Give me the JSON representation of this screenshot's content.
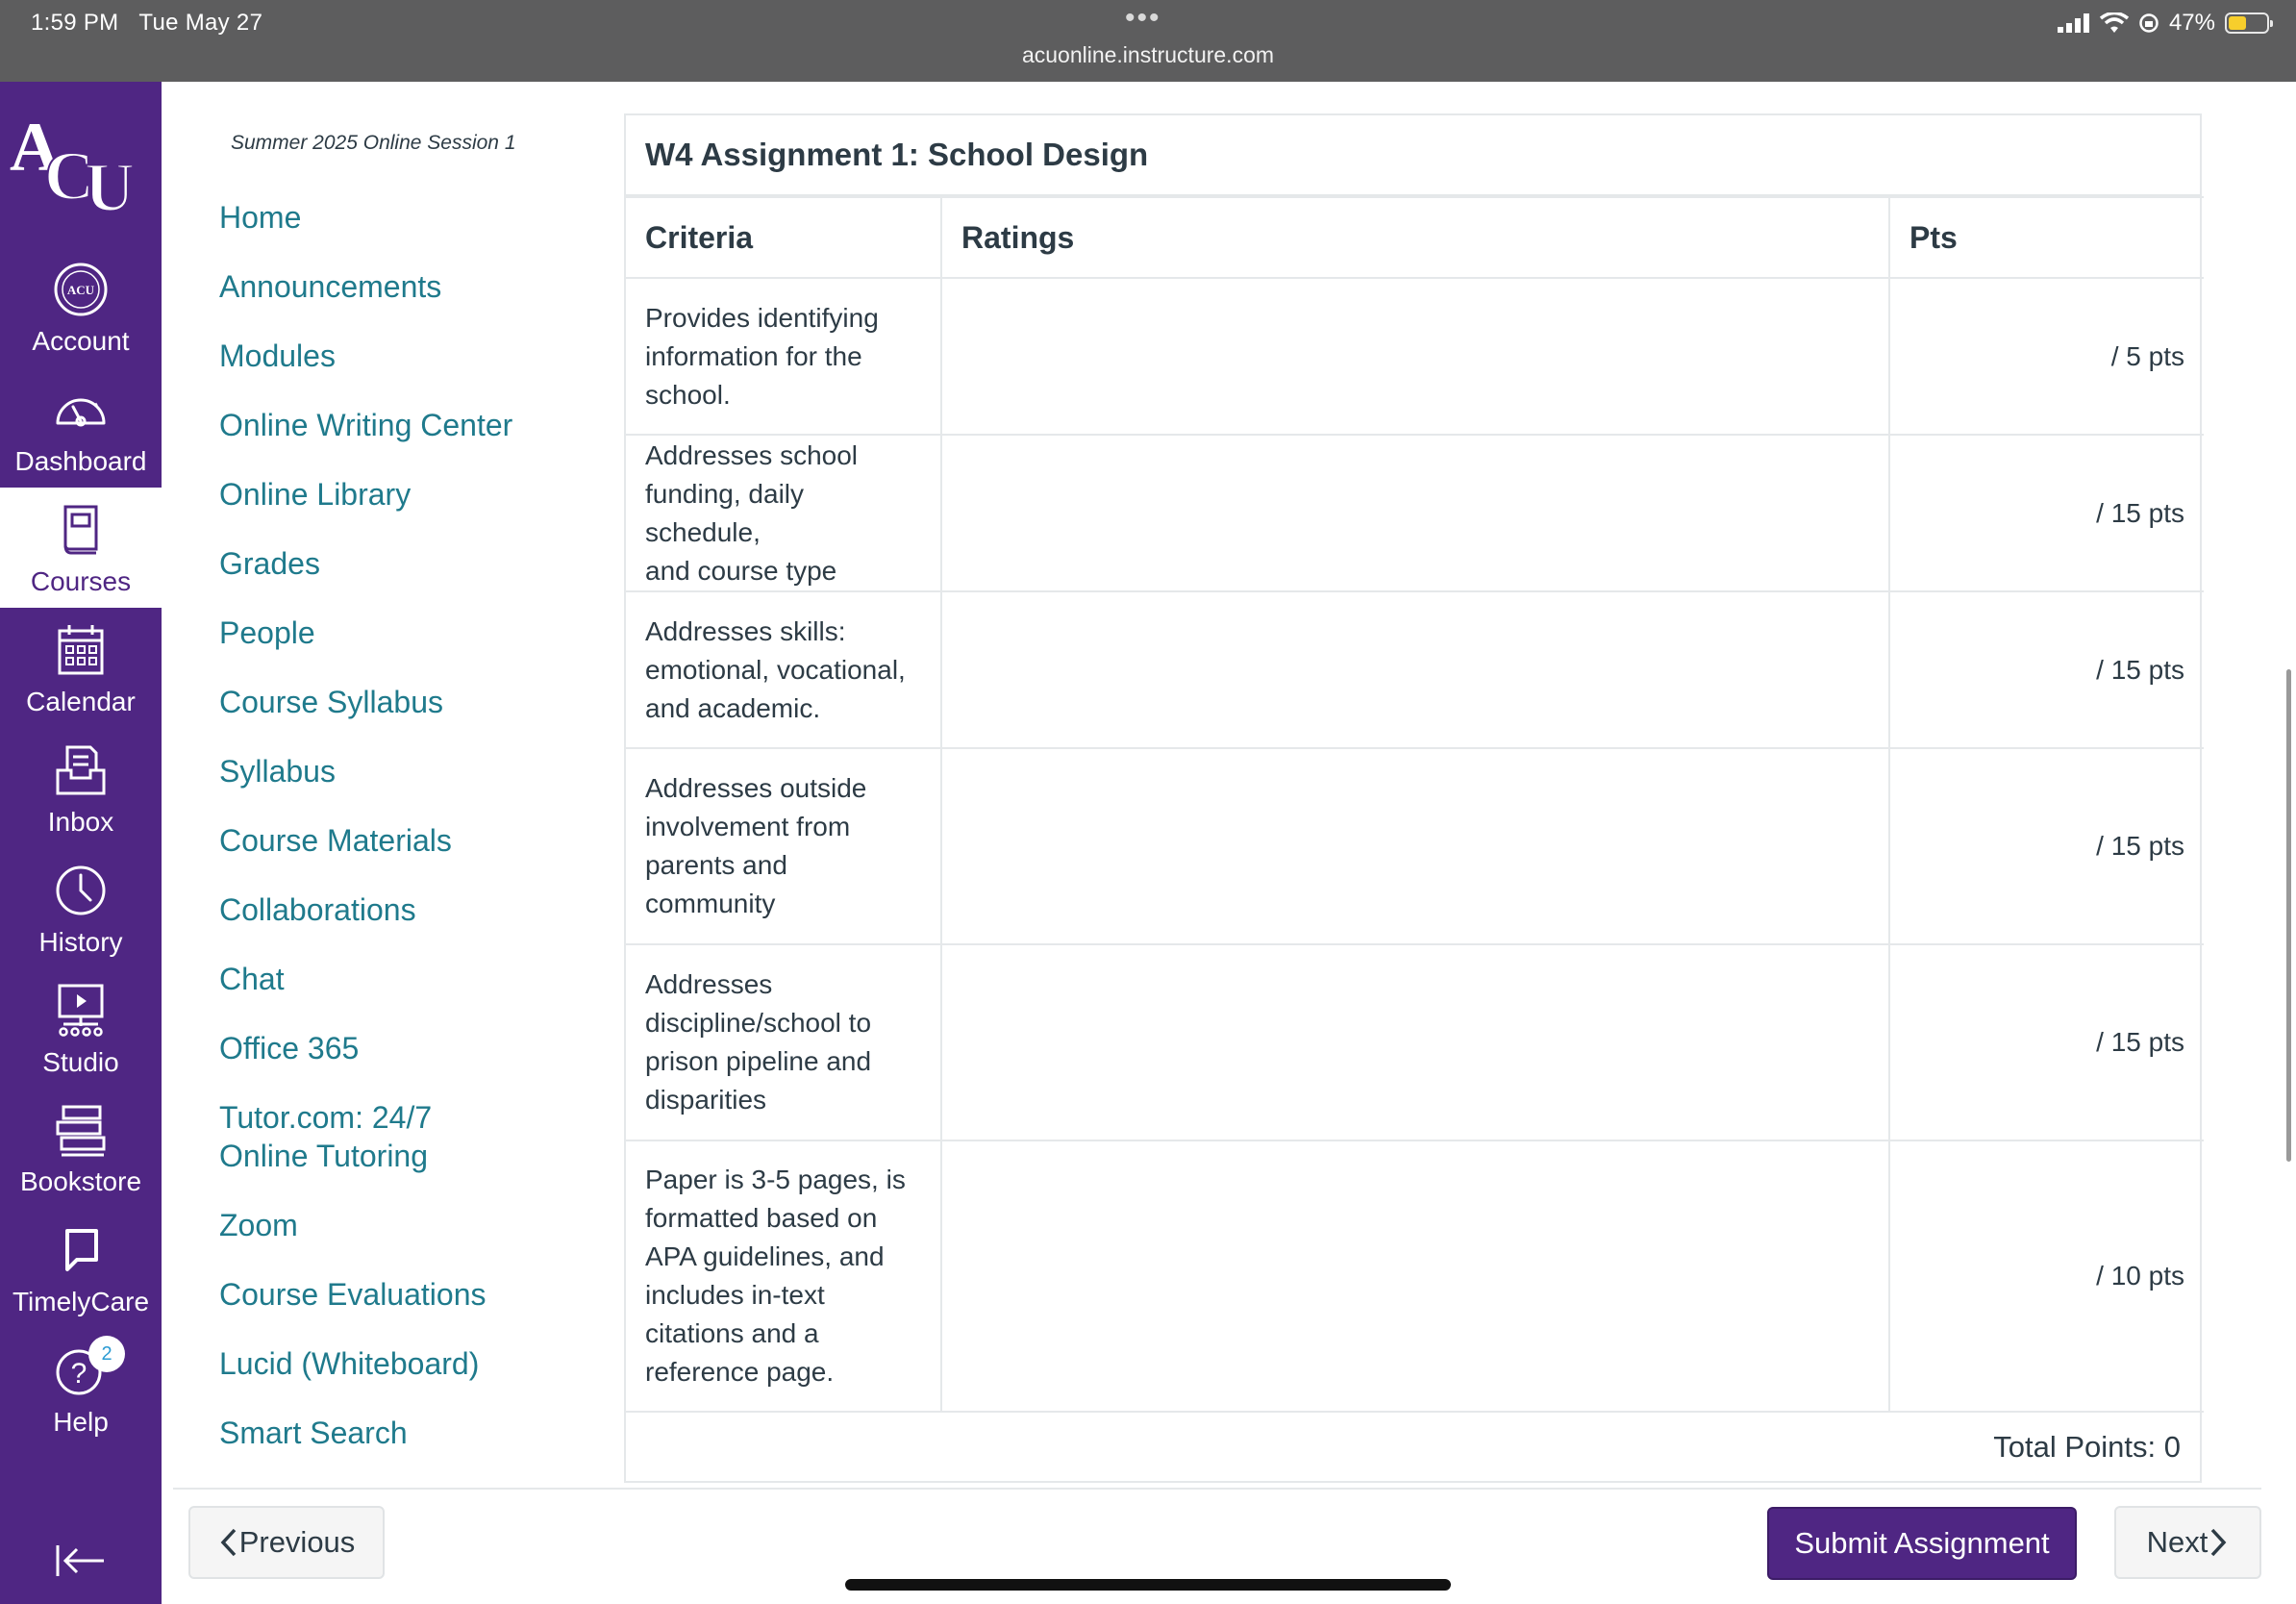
{
  "status_bar": {
    "time": "1:59 PM",
    "date": "Tue May 27",
    "url": "acuonline.instructure.com",
    "battery": "47%",
    "battery_level": 0.47,
    "battery_color": "#f7ce2c"
  },
  "global_nav": {
    "brand_color": "#4f2683",
    "logo_text": "ACU",
    "items": [
      {
        "label": "Account",
        "icon": "account-avatar-icon"
      },
      {
        "label": "Dashboard",
        "icon": "dashboard-gauge-icon"
      },
      {
        "label": "Courses",
        "icon": "courses-book-icon",
        "active": true
      },
      {
        "label": "Calendar",
        "icon": "calendar-icon"
      },
      {
        "label": "Inbox",
        "icon": "inbox-icon"
      },
      {
        "label": "History",
        "icon": "history-clock-icon"
      },
      {
        "label": "Studio",
        "icon": "studio-icon"
      },
      {
        "label": "Bookstore",
        "icon": "bookstore-books-icon"
      },
      {
        "label": "TimelyCare",
        "icon": "timelycare-chat-icon"
      },
      {
        "label": "Help",
        "icon": "help-question-icon",
        "badge": "2"
      }
    ]
  },
  "course_nav": {
    "term": "Summer 2025 Online Session 1",
    "link_color": "#1f7a8c",
    "links": [
      {
        "label": "Home"
      },
      {
        "label": "Announcements"
      },
      {
        "label": "Modules"
      },
      {
        "label": "Online Writing Center"
      },
      {
        "label": "Online Library"
      },
      {
        "label": "Grades"
      },
      {
        "label": "People"
      },
      {
        "label": "Course Syllabus"
      },
      {
        "label": "Syllabus"
      },
      {
        "label": "Course Materials"
      },
      {
        "label": "Collaborations"
      },
      {
        "label": "Chat"
      },
      {
        "label": "Office 365"
      },
      {
        "label": "Tutor.com: 24/7",
        "label2": "Online Tutoring"
      },
      {
        "label": "Zoom"
      },
      {
        "label": "Course Evaluations"
      },
      {
        "label": "Lucid (Whiteboard)"
      },
      {
        "label": "Smart Search"
      }
    ]
  },
  "rubric": {
    "title": "W4 Assignment 1: School Design",
    "headers": {
      "criteria": "Criteria",
      "ratings": "Ratings",
      "pts": "Pts"
    },
    "rows": [
      {
        "lines": [
          "Provides identifying",
          "information for the",
          "school."
        ],
        "pts": "/ 5 pts"
      },
      {
        "lines": [
          "Addresses school",
          "funding, daily schedule,",
          "and course type"
        ],
        "pts": "/ 15 pts"
      },
      {
        "lines": [
          "Addresses skills:",
          "emotional, vocational,",
          "and academic."
        ],
        "pts": "/ 15 pts"
      },
      {
        "lines": [
          "Addresses outside",
          "involvement from",
          "parents and",
          "community"
        ],
        "pts": "/ 15 pts"
      },
      {
        "lines": [
          "Addresses",
          "discipline/school to",
          "prison pipeline and",
          "disparities"
        ],
        "pts": "/ 15 pts"
      },
      {
        "lines": [
          "Paper is 3-5 pages, is",
          "formatted based on",
          "APA guidelines, and",
          "includes in-text",
          "citations and a",
          "reference page."
        ],
        "pts": "/ 10 pts"
      }
    ],
    "total": "Total Points: 0"
  },
  "footer": {
    "previous": "Previous",
    "submit": "Submit Assignment",
    "next": "Next"
  }
}
